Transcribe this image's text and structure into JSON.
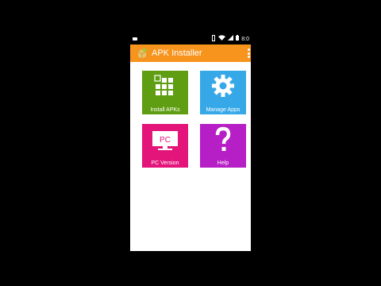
{
  "status_bar": {
    "left_icon": "notification-icon",
    "right_icons": [
      "vibrate-icon",
      "wifi-icon",
      "cell-signal-icon",
      "battery-icon"
    ],
    "time": "8:0"
  },
  "app_bar": {
    "icon": "apk-installer-logo-icon",
    "title": "APK Installer",
    "overflow_icon": "more-vert-icon"
  },
  "tiles": [
    {
      "label": "Install APKs",
      "color": "#5f9e12",
      "icon": "grid-icon"
    },
    {
      "label": "Manage Apps",
      "color": "#36a8e8",
      "icon": "gear-icon"
    },
    {
      "label": "PC Version",
      "color": "#e3147a",
      "icon": "monitor-icon",
      "icon_text": "PC"
    },
    {
      "label": "Help",
      "color": "#b61ec6",
      "icon": "question-mark-icon"
    }
  ],
  "colors": {
    "accent": "#f7941d",
    "background": "#000000",
    "content": "#ffffff"
  }
}
